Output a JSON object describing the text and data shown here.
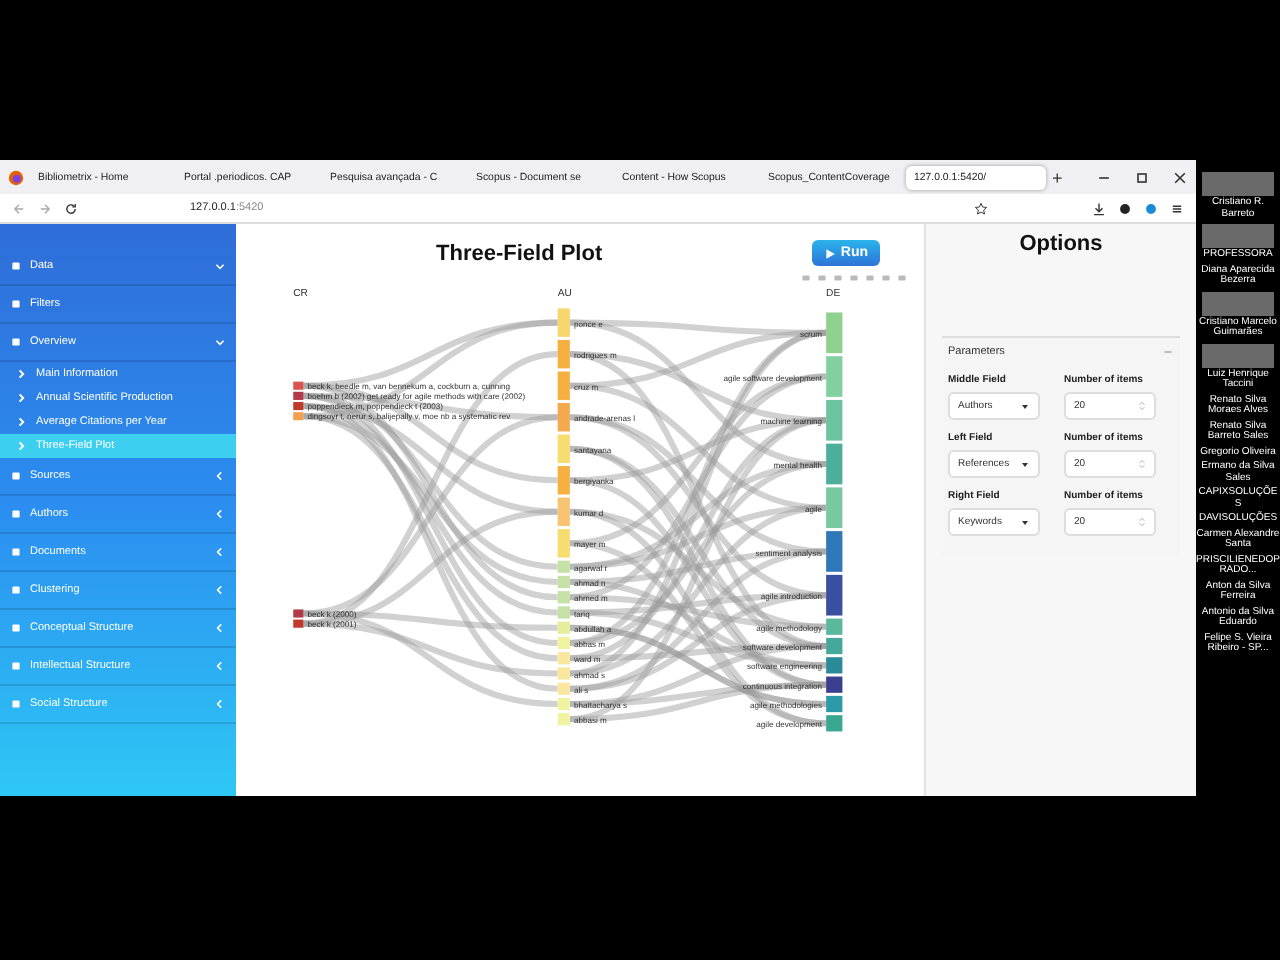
{
  "browser": {
    "tabs": [
      {
        "label": "Bibliometrix - Home",
        "selected": false
      },
      {
        "label": "Portal .periodicos. CAP",
        "selected": false
      },
      {
        "label": "Pesquisa avançada - C",
        "selected": false
      },
      {
        "label": "Scopus - Document se",
        "selected": false
      },
      {
        "label": "Content - How Scopus",
        "selected": false
      },
      {
        "label": "Scopus_ContentCoverage",
        "selected": false
      },
      {
        "label": "127.0.0.1:5420/",
        "selected": true
      }
    ],
    "new_tab": "+",
    "url_host": "127.0.0.1",
    "url_port": ":5420"
  },
  "sidebar": {
    "items": [
      {
        "label": "Data",
        "kind": "menu",
        "expanded": true,
        "selected": false
      },
      {
        "label": "Filters",
        "kind": "link",
        "selected": false
      },
      {
        "label": "Overview",
        "kind": "menu",
        "expanded": true,
        "selected": false
      },
      {
        "label": "Main Information",
        "kind": "sub",
        "selected": false
      },
      {
        "label": "Annual Scientific Production",
        "kind": "sub",
        "selected": false
      },
      {
        "label": "Average Citations per Year",
        "kind": "sub",
        "selected": false
      },
      {
        "label": "Three-Field Plot",
        "kind": "sub",
        "selected": true
      },
      {
        "label": "Sources",
        "kind": "menu",
        "expanded": false,
        "selected": false
      },
      {
        "label": "Authors",
        "kind": "menu",
        "expanded": false,
        "selected": false
      },
      {
        "label": "Documents",
        "kind": "menu",
        "expanded": false,
        "selected": false
      },
      {
        "label": "Clustering",
        "kind": "menu",
        "expanded": false,
        "selected": false
      },
      {
        "label": "Conceptual Structure",
        "kind": "menu",
        "expanded": false,
        "selected": false
      },
      {
        "label": "Intellectual Structure",
        "kind": "menu",
        "expanded": false,
        "selected": false
      },
      {
        "label": "Social Structure",
        "kind": "menu",
        "expanded": false,
        "selected": false
      }
    ]
  },
  "plot": {
    "title": "Three-Field Plot",
    "run_button": "Run",
    "columns": [
      "CR",
      "AU",
      "DE"
    ],
    "left_nodes": [
      {
        "label": "beck k, beedle m, van bennekum a, cockburn a, cunning",
        "color": "#d9534f"
      },
      {
        "label": "boehm b (2002) get ready for agile methods with care (2002)",
        "color": "#b03a48"
      },
      {
        "label": "poppendieck m, poppendieck t (2003)",
        "color": "#c0392b"
      },
      {
        "label": "dingsoyr t, nerur s, balijepally v, moe nb a systematic rev",
        "color": "#f0a050"
      },
      {
        "label": "beck k (2000)",
        "color": "#b03a48"
      },
      {
        "label": "beck k (2001)",
        "color": "#c0392b"
      }
    ],
    "middle_nodes": [
      {
        "label": "ponce e",
        "color": "#f5d76e"
      },
      {
        "label": "rodrigues m",
        "color": "#f5b041"
      },
      {
        "label": "cruz m",
        "color": "#f5b041"
      },
      {
        "label": "andrade-arenas l",
        "color": "#f5a94e"
      },
      {
        "label": "santayana",
        "color": "#f7dc6f"
      },
      {
        "label": "bergiyanka",
        "color": "#f5b041"
      },
      {
        "label": "kumar d",
        "color": "#f8c471"
      },
      {
        "label": "mayer m",
        "color": "#f7dc6f"
      },
      {
        "label": "agarwal r",
        "color": "#c5e1a5"
      },
      {
        "label": "ahmad n",
        "color": "#c5e1a5"
      },
      {
        "label": "ahmed m",
        "color": "#c5e1a5"
      },
      {
        "label": "tariq",
        "color": "#c5e1a5"
      },
      {
        "label": "abdullah a",
        "color": "#e6ee9c"
      },
      {
        "label": "abbas m",
        "color": "#f0f4a0"
      },
      {
        "label": "ward m",
        "color": "#f9e79f"
      },
      {
        "label": "ahmad s",
        "color": "#f9e79f"
      },
      {
        "label": "ali s",
        "color": "#f9e79f"
      },
      {
        "label": "bhattacharya s",
        "color": "#f0f4a0"
      },
      {
        "label": "abbasi m",
        "color": "#f0f4a0"
      }
    ],
    "right_nodes": [
      {
        "label": "scrum",
        "color": "#8fd18f"
      },
      {
        "label": "agile software development",
        "color": "#82d0a0"
      },
      {
        "label": "machine learning",
        "color": "#6cc3a0"
      },
      {
        "label": "mental health",
        "color": "#4daf9a"
      },
      {
        "label": "agile",
        "color": "#78c8a0"
      },
      {
        "label": "sentiment analysis",
        "color": "#2e78b8"
      },
      {
        "label": "agile introduction",
        "color": "#3a4fa0"
      },
      {
        "label": "agile methodology",
        "color": "#5cb89a"
      },
      {
        "label": "software development",
        "color": "#46a89a"
      },
      {
        "label": "software engineering",
        "color": "#2a8a9a"
      },
      {
        "label": "continuous integration",
        "color": "#3a3f8f"
      },
      {
        "label": "agile methodologies",
        "color": "#2c9aa8"
      },
      {
        "label": "agile development",
        "color": "#3aa890"
      }
    ]
  },
  "options": {
    "title": "Options",
    "section": "Parameters",
    "fields": [
      {
        "label": "Middle Field",
        "value": "Authors",
        "count_label": "Number of items",
        "count": "20"
      },
      {
        "label": "Left Field",
        "value": "References",
        "count_label": "Number of items",
        "count": "20"
      },
      {
        "label": "Right Field",
        "value": "Keywords",
        "count_label": "Number of items",
        "count": "20"
      }
    ]
  },
  "participants": [
    {
      "name": "Cristiano R. Barreto",
      "video": true
    },
    {
      "name": "PROFESSORA",
      "video": true
    },
    {
      "name": "Diana Aparecida Bezerra",
      "video": false
    },
    {
      "name": "Cristiano Marcelo Guimarães",
      "video": true
    },
    {
      "name": "Luiz Henrique Taccini",
      "video": true
    },
    {
      "name": "Renato Silva Moraes Alves",
      "video": false
    },
    {
      "name": "Renato Silva Barreto Sales",
      "video": false
    },
    {
      "name": "Gregorio Oliveira",
      "video": false
    },
    {
      "name": "Ermano da Silva Sales",
      "video": false
    },
    {
      "name": "CAPIXSOLUÇÕES",
      "video": false
    },
    {
      "name": "DAVISOLUÇÕES",
      "video": false
    },
    {
      "name": "Carmen Alexandre Santa",
      "video": false
    },
    {
      "name": "PRISCILIENEDOPRADO...",
      "video": false
    },
    {
      "name": "Anton da Silva Ferreira",
      "video": false
    },
    {
      "name": "Antonio da Silva Eduardo",
      "video": false
    },
    {
      "name": "Felipe S. Vieira Ribeiro - SP...",
      "video": false
    }
  ]
}
